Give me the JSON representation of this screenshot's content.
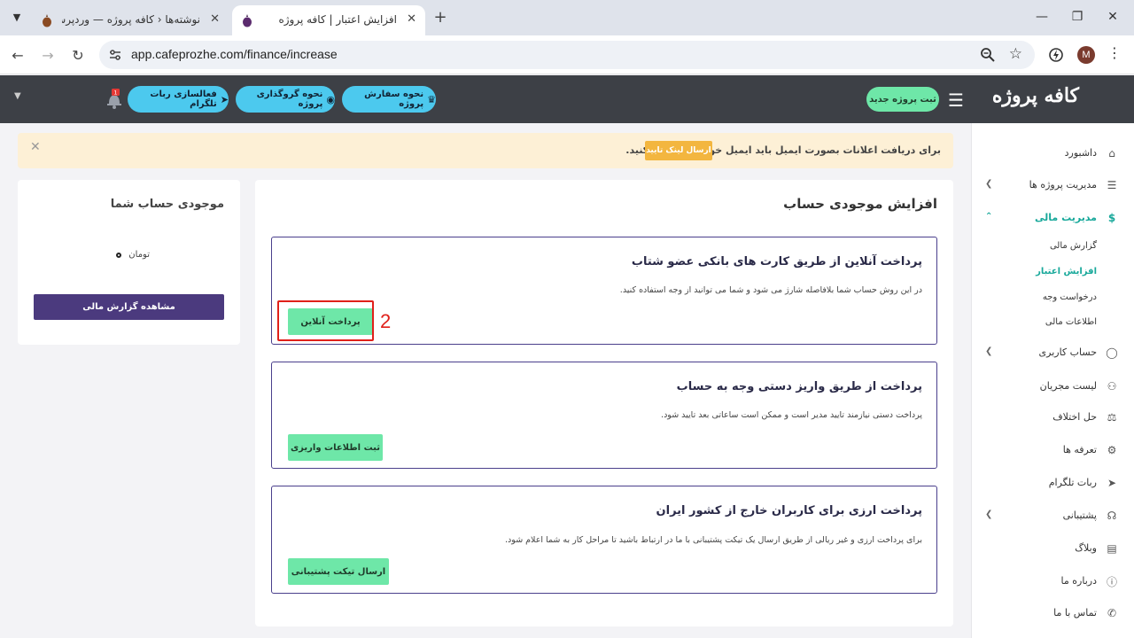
{
  "browser": {
    "tabs": [
      {
        "title": "نوشته‌ها ‹ کافه پروژه — وردپرس",
        "active": false
      },
      {
        "title": "افزایش اعتبار | کافه پروژه",
        "active": true
      }
    ],
    "url": "app.cafeprozhe.com/finance/increase",
    "profile_initial": "M"
  },
  "header": {
    "logo": "کافه پروژه",
    "new_project_label": "ثبت پروژه جدید",
    "pills": [
      {
        "label": "نحوه سفارش پروژه",
        "icon": "robot-icon"
      },
      {
        "label": "نحوه گروگذاری پروژه",
        "icon": "money-bag-icon"
      },
      {
        "label": "فعالسازی ربات تلگرام",
        "icon": "telegram-icon"
      }
    ],
    "notification_count": "1"
  },
  "sidebar": {
    "items": [
      {
        "label": "داشبورد",
        "icon": "home-icon",
        "arrow": false
      },
      {
        "label": "مدیریت پروژه ها",
        "icon": "list-icon",
        "arrow": true
      },
      {
        "label": "مدیریت مالی",
        "icon": "dollar-icon",
        "arrow": true,
        "active": true
      },
      {
        "label": "حساب کاربری",
        "icon": "user-icon",
        "arrow": true
      },
      {
        "label": "لیست مجریان",
        "icon": "users-icon",
        "arrow": false
      },
      {
        "label": "حل اختلاف",
        "icon": "scale-icon",
        "arrow": false
      },
      {
        "label": "تعرفه ها",
        "icon": "settings-icon",
        "arrow": false
      },
      {
        "label": "ربات تلگرام",
        "icon": "send-icon",
        "arrow": false
      },
      {
        "label": "پشتیبانی",
        "icon": "headphones-icon",
        "arrow": true
      },
      {
        "label": "وبلاگ",
        "icon": "book-icon",
        "arrow": false
      },
      {
        "label": "درباره ما",
        "icon": "info-icon",
        "arrow": false
      },
      {
        "label": "تماس با ما",
        "icon": "phone-icon",
        "arrow": false
      }
    ],
    "finance_sub": [
      {
        "label": "گزارش مالی",
        "active": false
      },
      {
        "label": "افزایش اعتبار",
        "active": true
      },
      {
        "label": "درخواست وجه",
        "active": false
      },
      {
        "label": "اطلاعات مالی",
        "active": false
      }
    ]
  },
  "alert": {
    "text": "برای دریافت اعلانات بصورت ایمیل باید ایمیل خودتان را تایید کنید.",
    "button_label": "ارسال لینک تایید"
  },
  "main": {
    "title": "افزایش موجودی حساب",
    "options": [
      {
        "title": "پرداخت آنلاین از طریق کارت های بانکی عضو شتاب",
        "description": "در این روش حساب شما بلافاصله شارژ می شود و شما می توانید از وجه استفاده کنید.",
        "button_label": "پرداخت آنلاین"
      },
      {
        "title": "پرداخت از طریق واریز دستی وجه به حساب",
        "description": "پرداخت دستی نیازمند تایید مدیر است و ممکن است ساعاتی بعد تایید شود.",
        "button_label": "ثبت اطلاعات واریزی"
      },
      {
        "title": "پرداخت ارزی برای کاربران خارج از کشور ایران",
        "description": "برای پرداخت ارزی و غیر ریالی از طریق ارسال یک تیکت پشتیبانی با ما در ارتباط باشید تا مراحل کار به شما اعلام شود.",
        "button_label": "ارسال تیکت پشتیبانی"
      }
    ],
    "annotation_label": "2"
  },
  "balance": {
    "title": "موجودی حساب شما",
    "currency": "تومان",
    "button_label": "مشاهده گزارش مالی"
  },
  "colors": {
    "accent_green": "#6ee7a8",
    "accent_teal": "#17a89a",
    "header_bg": "#3d4046",
    "pill_blue": "#4cc9ee",
    "purple": "#4b3a7e",
    "annotation_red": "#e0201a"
  }
}
